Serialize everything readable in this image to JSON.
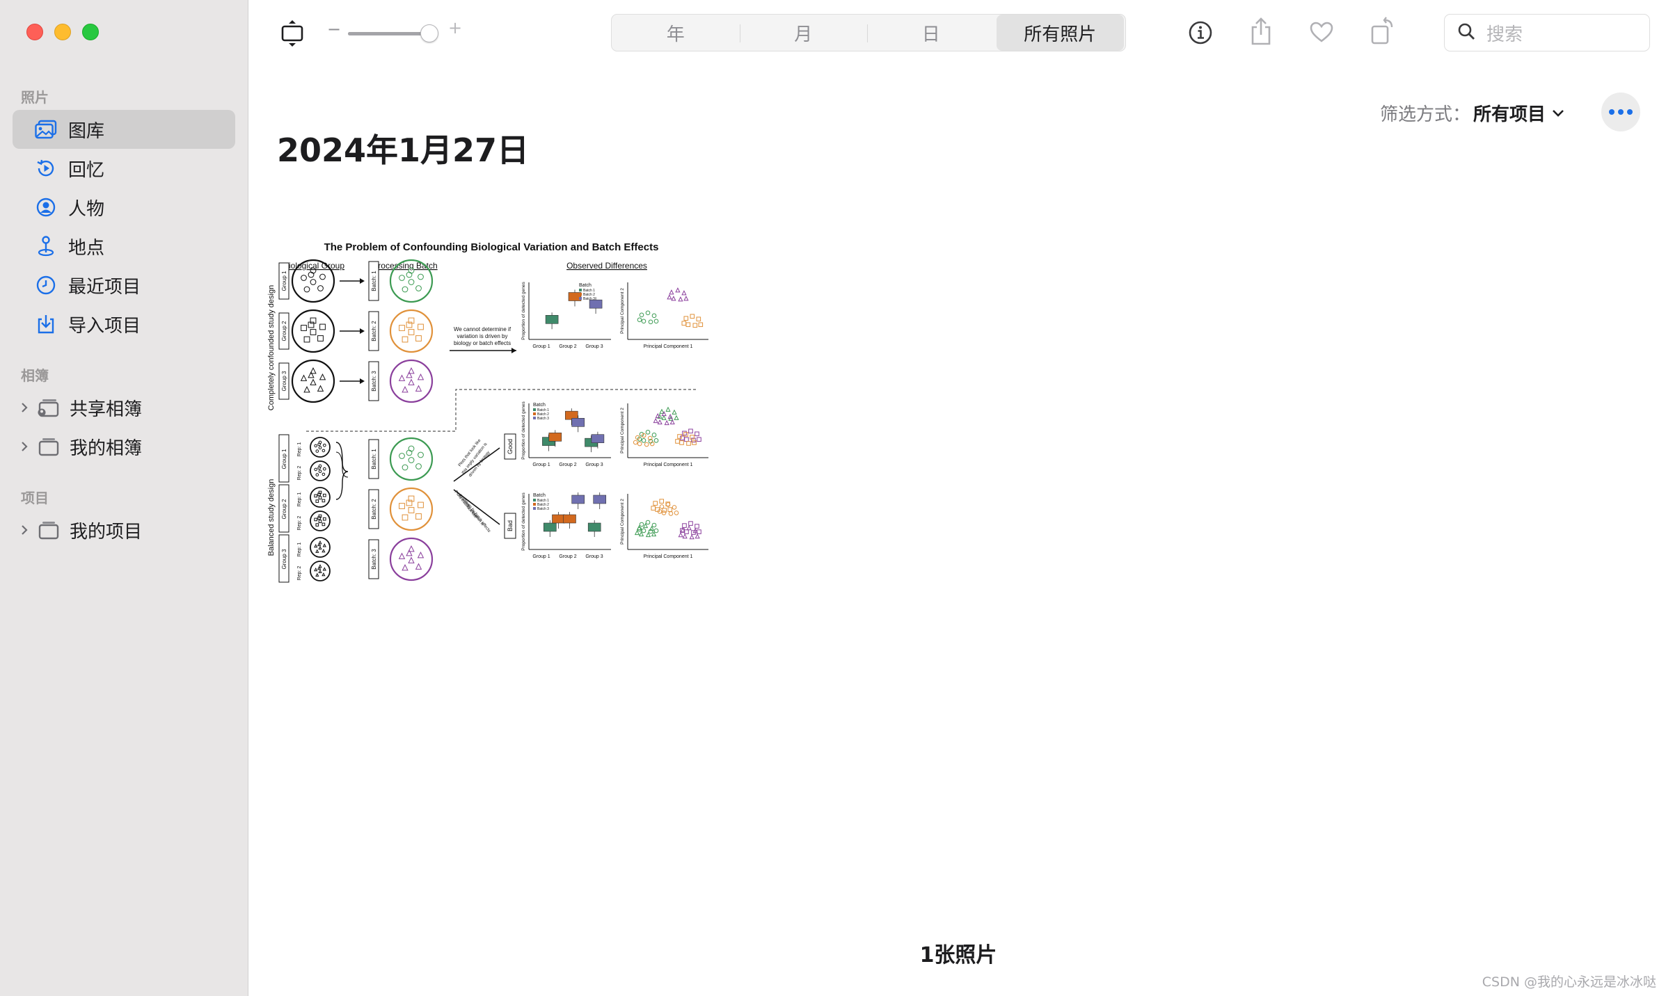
{
  "sidebar": {
    "sections": {
      "photos": "照片",
      "albums": "相簿",
      "projects": "项目"
    },
    "items": [
      {
        "label": "图库",
        "icon": "library-icon",
        "active": true
      },
      {
        "label": "回忆",
        "icon": "memories-icon"
      },
      {
        "label": "人物",
        "icon": "people-icon"
      },
      {
        "label": "地点",
        "icon": "places-icon"
      },
      {
        "label": "最近项目",
        "icon": "recent-icon"
      },
      {
        "label": "导入项目",
        "icon": "imports-icon"
      }
    ],
    "albums": [
      {
        "label": "共享相簿",
        "icon": "shared-albums-icon"
      },
      {
        "label": "我的相簿",
        "icon": "my-albums-icon"
      }
    ],
    "projects": [
      {
        "label": "我的项目",
        "icon": "my-projects-icon"
      }
    ]
  },
  "toolbar": {
    "zoom_minus": "−",
    "zoom_plus": "+",
    "zoom_level": 0.85,
    "segments": [
      {
        "label": "年",
        "active": false
      },
      {
        "label": "月",
        "active": false
      },
      {
        "label": "日",
        "active": false
      },
      {
        "label": "所有照片",
        "active": true
      }
    ],
    "search_placeholder": "搜索"
  },
  "main": {
    "filter_label": "筛选方式：",
    "filter_value": "所有项目",
    "date_title": "2024年1月27日",
    "photo_count": "1张照片"
  },
  "photo": {
    "title": "The Problem of Confounding Biological Variation and Batch Effects",
    "col_bio": "Biological Group",
    "col_batch": "Processing Batch",
    "col_obs": "Observed Differences",
    "design_confounded": "Completely confounded study design",
    "design_balanced": "Balanced study design",
    "note": [
      "We cannot determine if",
      "variation is driven by",
      "biology or batch effects"
    ],
    "good": "Good",
    "bad": "Bad",
    "ylabel_box": "Proportion of detected genes",
    "ylabel_pca": "Principal Component 2",
    "xlabel_pca": "Principal Component 1",
    "groups": [
      "Group 1",
      "Group 2",
      "Group 3"
    ],
    "legend_title": "Batch",
    "legend": [
      "Batch 1",
      "Batch 2",
      "Batch 3"
    ]
  },
  "colors": {
    "accent": "#1b6fe8",
    "green": "#3c9a52",
    "orange": "#e0913a",
    "purple": "#8a3f9c",
    "box_green": "#3f8a6a",
    "box_orange": "#d2691e",
    "box_purple": "#7070b0"
  },
  "watermark": "CSDN @我的心永远是冰冰哒"
}
